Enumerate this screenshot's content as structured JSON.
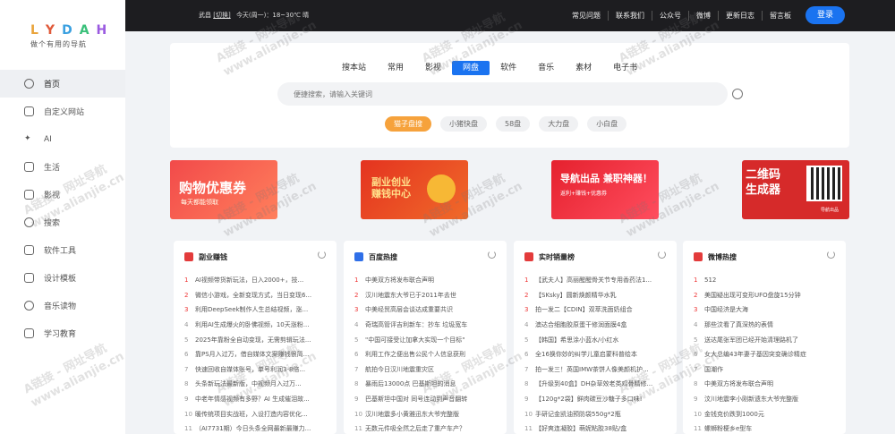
{
  "logo": {
    "mark": [
      "L",
      "Y",
      "D",
      "A",
      "H"
    ],
    "subtitle": "做个有用的导航"
  },
  "sidebar": {
    "items": [
      {
        "label": "首页",
        "icon": "home-icon",
        "active": true
      },
      {
        "label": "自定义网站",
        "icon": "edit-icon"
      },
      {
        "label": "AI",
        "icon": "ai-icon"
      },
      {
        "label": "生活",
        "icon": "bag-icon"
      },
      {
        "label": "影视",
        "icon": "video-icon"
      },
      {
        "label": "搜索",
        "icon": "search-icon"
      },
      {
        "label": "软件工具",
        "icon": "tools-icon"
      },
      {
        "label": "设计模板",
        "icon": "template-icon"
      },
      {
        "label": "音乐读物",
        "icon": "music-icon"
      },
      {
        "label": "学习教育",
        "icon": "education-icon"
      }
    ]
  },
  "topbar": {
    "location": "武昌",
    "location_switch": "[切换]",
    "weather": "今天(周一)：18~30℃ 晴",
    "links": [
      "常见问题",
      "联系我们",
      "公众号",
      "微博",
      "更新日志",
      "留言板"
    ],
    "login": "登录"
  },
  "search": {
    "tabs": [
      "搜本站",
      "常用",
      "影视",
      "网盘",
      "软件",
      "音乐",
      "素材",
      "电子书"
    ],
    "active_tab": "网盘",
    "placeholder": "便捷搜索，请输入关键词",
    "engines": [
      "猫子盘搜",
      "小猪快盘",
      "58盘",
      "大力盘",
      "小白盘"
    ],
    "active_engine": "猫子盘搜"
  },
  "banners": [
    {
      "title": "购物优惠券",
      "sub": "每天都能领取"
    },
    {
      "title": "副业创业\n赚钱中心",
      "sub": ""
    },
    {
      "title": "导航出品 兼职神器！",
      "sub": "返利+赚钱+优惠券"
    },
    {
      "title": "二维码\n生成器",
      "sub": "导航出品"
    }
  ],
  "cards": [
    {
      "title": "副业赚钱",
      "color": "#e33b3b",
      "items": [
        "AI视频带货新玩法，日入2000+，技...",
        "微信小游戏，全新变现方式，当日变现6...",
        "利用DeepSeek制作人生总结视频，涨...",
        "利用AI生成爆火的卧佛视频，10天涨粉...",
        "2025年靠粉全自动变现，无需剪辑玩法...",
        "靠PS月入过万，借自媒体文案赚钱很简...",
        "快速回收自媒体账号，单号利润3-8倍...",
        "头条新玩法最新版，中视频月入过万...",
        "中老年情感视频有多野？AI 生成催泪故...",
        "暖传统项目实战班，入设打造内容优化...",
        "（AI7731期）今日头条全网最新最赚力..."
      ]
    },
    {
      "title": "百度热搜",
      "color": "#2f6fe8",
      "items": [
        "中美双方将发布联合声明",
        "汉川地震东大爷已于2011年去世",
        "中美经贸高层会谈达成重要共识",
        "奇瑞高管评吉利新车：抄车 垃圾宽车",
        "\"中国可接受让加拿大实现一个目标\"",
        "利用工作之便出售公民个人信息获刑",
        "航拍今日汉川地震重灾区",
        "暴雨后13000点 巴基斯坦的消息",
        "巴基斯坦中国对 同号连动到声音翻转",
        "汉川地震多小黄雅迅东大爷完整版",
        "无数元件吸全然之后走了重产车产？"
      ]
    },
    {
      "title": "实时销量榜",
      "color": "#e33b3b",
      "items": [
        "【武夫人】高丽醒醒骨关节专用香药法1...",
        "【SKsky】圆新焕颜精华水乳",
        "拍一发二【CDIN】双萃洗面奶组合",
        "澳达合细胞胶原蛋干修润面膜4盒",
        "【韩国】希思涂小蓝水/小红水",
        "全16换你妙的纠学儿童启蒙科普绘本",
        "拍一发三！英国IMW茶饼人像美颜机护...",
        "【升级到40盒】DH杂草效老类鸡骨精修...",
        "【120g*2袋】鲜肉碳豆沙糖子多口味!",
        "手研记金凯油预防袋550g*2瓶",
        "【好爽连凝胶】萌妮粘胶38贴/盒"
      ]
    },
    {
      "title": "微博热搜",
      "color": "#e33b3b",
      "items": [
        "512",
        "美国疑出现可变形UFO盘旋15分钟",
        "中国经济是大海",
        "那些汶看了真深热的表情",
        "送达尾张军团已经开始清理路机了",
        "女大总编43年妻子基因突变确诊精症",
        "国潮作",
        "中美双方将发布联合声明",
        "汶川地震李小刚新遗东大爷完整版",
        "金钱克价跌到1000元",
        "螺蛳粉梗乡e型车"
      ]
    }
  ],
  "watermark": {
    "text": "A链接 - 网址导航",
    "url": "www.alianjie.cn"
  },
  "colors": {
    "accent": "#1a73f0",
    "engine_active": "#f6a23c",
    "topbar": "#1d1d20",
    "hot_rank": "#e33333"
  }
}
